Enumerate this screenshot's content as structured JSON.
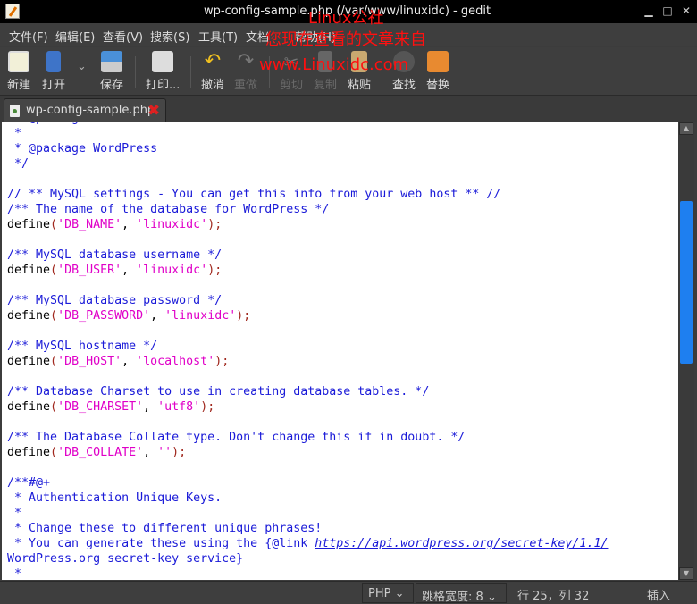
{
  "window": {
    "title": "wp-config-sample.php (/var/www/linuxidc) - gedit"
  },
  "menu": [
    "文件(F)",
    "编辑(E)",
    "查看(V)",
    "搜索(S)",
    "工具(T)",
    "文档",
    "帮助(H)"
  ],
  "toolbar": [
    {
      "id": "new",
      "label": "新建",
      "icon": "new-document-icon",
      "enabled": true
    },
    {
      "id": "open",
      "label": "打开",
      "icon": "open-icon",
      "enabled": true
    },
    {
      "id": "save",
      "label": "保存",
      "icon": "save-icon",
      "enabled": true
    },
    {
      "id": "print",
      "label": "打印...",
      "icon": "print-icon",
      "enabled": true
    },
    {
      "id": "undo",
      "label": "撤消",
      "icon": "undo-icon",
      "enabled": true
    },
    {
      "id": "redo",
      "label": "重做",
      "icon": "redo-icon",
      "enabled": false
    },
    {
      "id": "cut",
      "label": "剪切",
      "icon": "cut-icon",
      "enabled": false
    },
    {
      "id": "copy",
      "label": "复制",
      "icon": "copy-icon",
      "enabled": false
    },
    {
      "id": "paste",
      "label": "粘贴",
      "icon": "paste-icon",
      "enabled": true
    },
    {
      "id": "find",
      "label": "查找",
      "icon": "find-icon",
      "enabled": true
    },
    {
      "id": "replace",
      "label": "替换",
      "icon": "replace-icon",
      "enabled": true
    }
  ],
  "tab": {
    "label": "wp-config-sample.php"
  },
  "code": [
    [
      [
        "c",
        " * @package WordPress"
      ]
    ],
    [
      [
        "c",
        " *"
      ]
    ],
    [
      [
        "c",
        " * @package WordPress"
      ]
    ],
    [
      [
        "c",
        " */"
      ]
    ],
    [],
    [
      [
        "c",
        "// ** MySQL settings - You can get this info from your web host ** //"
      ]
    ],
    [
      [
        "c",
        "/** The name of the database for WordPress */"
      ]
    ],
    [
      [
        "k",
        "define"
      ],
      [
        "p",
        "("
      ],
      [
        "s",
        "'DB_NAME'"
      ],
      [
        "k",
        ", "
      ],
      [
        "s",
        "'linuxidc'"
      ],
      [
        "p",
        ");"
      ]
    ],
    [],
    [
      [
        "c",
        "/** MySQL database username */"
      ]
    ],
    [
      [
        "k",
        "define"
      ],
      [
        "p",
        "("
      ],
      [
        "s",
        "'DB_USER'"
      ],
      [
        "k",
        ", "
      ],
      [
        "s",
        "'linuxidc'"
      ],
      [
        "p",
        ");"
      ]
    ],
    [],
    [
      [
        "c",
        "/** MySQL database password */"
      ]
    ],
    [
      [
        "k",
        "define"
      ],
      [
        "p",
        "("
      ],
      [
        "s",
        "'DB_PASSWORD'"
      ],
      [
        "k",
        ", "
      ],
      [
        "s",
        "'linuxidc'"
      ],
      [
        "p",
        ");"
      ]
    ],
    [],
    [
      [
        "c",
        "/** MySQL hostname */"
      ]
    ],
    [
      [
        "k",
        "define"
      ],
      [
        "p",
        "("
      ],
      [
        "s",
        "'DB_HOST'"
      ],
      [
        "k",
        ", "
      ],
      [
        "s",
        "'localhost'"
      ],
      [
        "p",
        ");"
      ]
    ],
    [],
    [
      [
        "c",
        "/** Database Charset to use in creating database tables. */"
      ]
    ],
    [
      [
        "k",
        "define"
      ],
      [
        "p",
        "("
      ],
      [
        "s",
        "'DB_CHARSET'"
      ],
      [
        "k",
        ", "
      ],
      [
        "s",
        "'utf8'"
      ],
      [
        "p",
        ");"
      ]
    ],
    [],
    [
      [
        "c",
        "/** The Database Collate type. Don't change this if in doubt. */"
      ]
    ],
    [
      [
        "k",
        "define"
      ],
      [
        "p",
        "("
      ],
      [
        "s",
        "'DB_COLLATE'"
      ],
      [
        "k",
        ", "
      ],
      [
        "s",
        "''"
      ],
      [
        "p",
        ");"
      ]
    ],
    [],
    [
      [
        "c",
        "/**#@+"
      ]
    ],
    [
      [
        "c",
        " * Authentication Unique Keys."
      ]
    ],
    [
      [
        "c",
        " *"
      ]
    ],
    [
      [
        "c",
        " * Change these to different unique phrases!"
      ]
    ],
    [
      [
        "c",
        " * You can generate these using the {@link "
      ],
      [
        "l",
        "https://api.wordpress.org/secret-key/1.1/"
      ]
    ],
    [
      [
        "c",
        "WordPress.org secret-key service}"
      ]
    ],
    [
      [
        "c",
        " *"
      ]
    ]
  ],
  "status": {
    "language": "PHP",
    "tab_width": "跳格宽度: 8",
    "position": "行 25，列 32",
    "mode": "插入"
  },
  "watermark": {
    "line1": "Linux公社",
    "line2": "您现在查看的文章来自",
    "line3": "www.Linuxidc.com"
  }
}
